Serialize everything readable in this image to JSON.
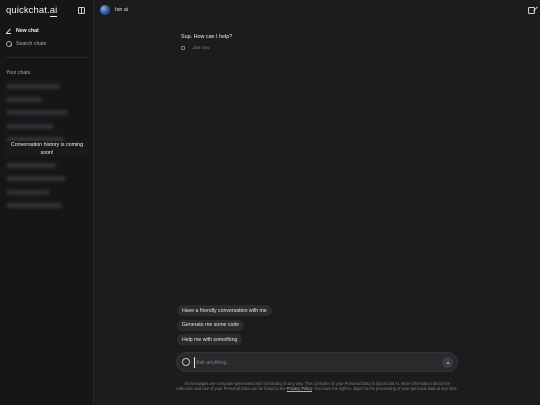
{
  "sidebar": {
    "brand": {
      "prefix": "quickchat.",
      "suffix": "ai"
    },
    "new_chat": "New chat",
    "search_chats": "Search chats",
    "your_chats": "Your chats",
    "history_note": "Conversation history is coming soon!"
  },
  "header": {
    "bot_name": "Ion ai"
  },
  "conversation": {
    "bot_message": "Sup. How can I help?",
    "meta_separator": "·",
    "timestamp": "Just now"
  },
  "suggestions": [
    "Have a friendly conversation with me",
    "Generate me some code",
    "Help me with something"
  ],
  "composer": {
    "placeholder": "Ask anything..."
  },
  "disclaimer": {
    "part1": "All messages are computer-generated and not binding in any way. The controller of your Personal Data is Quickchat AI. More information about the collection and use of your Personal Data can be found in the ",
    "link": "Privacy Policy",
    "part2": ". You have the right to object to the processing of your personal data at any time."
  }
}
